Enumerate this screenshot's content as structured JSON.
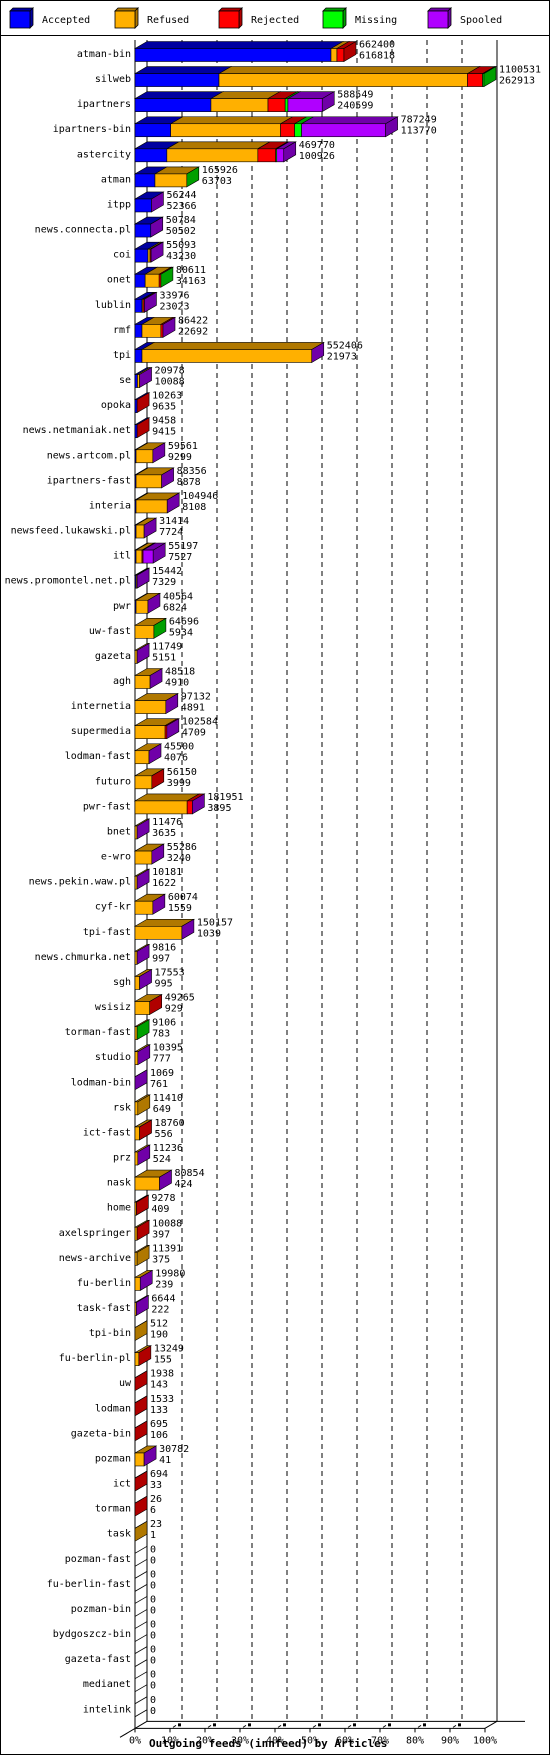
{
  "chart_data": {
    "type": "bar",
    "orientation": "horizontal",
    "stacked": true,
    "style": "3d",
    "title": "Outgoing feeds (innfeed) by Articles",
    "xlabel": "Outgoing feeds (innfeed) by Articles",
    "ylabel": "",
    "xlim": [
      0,
      100
    ],
    "x_ticks": [
      "0%",
      "10%",
      "20%",
      "30%",
      "40%",
      "50%",
      "60%",
      "70%",
      "80%",
      "90%",
      "100%"
    ],
    "grid": "vertical-dashed",
    "legend_position": "top",
    "legend": [
      {
        "name": "Accepted",
        "color": "#0000ff",
        "side": "#0000a0"
      },
      {
        "name": "Refused",
        "color": "#ffb000",
        "side": "#b07800"
      },
      {
        "name": "Rejected",
        "color": "#ff0000",
        "side": "#b00000"
      },
      {
        "name": "Missing",
        "color": "#00ff00",
        "side": "#00a000"
      },
      {
        "name": "Spooled",
        "color": "#b000ff",
        "side": "#7000a8"
      }
    ],
    "units_note": "segment values are percent of axis width (estimated)",
    "rows": [
      {
        "name": "atman-bin",
        "top": "662400",
        "bottom": "616818",
        "seg": [
          56,
          1.7,
          2,
          0,
          0
        ]
      },
      {
        "name": "silweb",
        "top": "1100531",
        "bottom": "262913",
        "seg": [
          24,
          71,
          4.3,
          0.4,
          0
        ]
      },
      {
        "name": "ipartners",
        "top": "588549",
        "bottom": "240599",
        "seg": [
          21.7,
          16.3,
          4.9,
          0.8,
          9.8
        ]
      },
      {
        "name": "ipartners-bin",
        "top": "787249",
        "bottom": "113770",
        "seg": [
          10.2,
          31.4,
          4,
          2,
          24
        ]
      },
      {
        "name": "astercity",
        "top": "469770",
        "bottom": "100926",
        "seg": [
          9.1,
          26,
          5.1,
          0.3,
          2
        ]
      },
      {
        "name": "atman",
        "top": "165926",
        "bottom": "63703",
        "seg": [
          5.7,
          9.1,
          0,
          0,
          0
        ],
        "last_side": "missing"
      },
      {
        "name": "itpp",
        "top": "56244",
        "bottom": "52366",
        "seg": [
          4.7,
          0,
          0,
          0,
          0
        ],
        "last_side": "spooled"
      },
      {
        "name": "news.connecta.pl",
        "top": "50784",
        "bottom": "50502",
        "seg": [
          4.5,
          0,
          0,
          0,
          0
        ],
        "last_side": "spooled"
      },
      {
        "name": "coi",
        "top": "55093",
        "bottom": "43230",
        "seg": [
          3.7,
          0.6,
          0.3,
          0,
          0
        ],
        "last_side": "spooled"
      },
      {
        "name": "onet",
        "top": "80611",
        "bottom": "34163",
        "seg": [
          2.9,
          4,
          0.5,
          0,
          0
        ],
        "last_side": "missing"
      },
      {
        "name": "lublin",
        "top": "33976",
        "bottom": "23023",
        "seg": [
          2,
          0.3,
          0.4,
          0,
          0
        ],
        "last_side": "spooled"
      },
      {
        "name": "rmf",
        "top": "86422",
        "bottom": "22692",
        "seg": [
          2,
          5.4,
          0.6,
          0,
          0
        ],
        "last_side": "spooled"
      },
      {
        "name": "tpi",
        "top": "552406",
        "bottom": "21973",
        "seg": [
          2,
          48.5,
          0,
          0,
          0
        ],
        "last_side": "spooled"
      },
      {
        "name": "se",
        "top": "20978",
        "bottom": "10088",
        "seg": [
          0.7,
          0.6,
          0,
          0,
          0
        ],
        "last_side": "spooled"
      },
      {
        "name": "opoka",
        "top": "10263",
        "bottom": "9635",
        "seg": [
          0.6,
          0,
          0,
          0,
          0
        ],
        "last_side": "rejected"
      },
      {
        "name": "news.netmaniak.net",
        "top": "9458",
        "bottom": "9415",
        "seg": [
          0.6,
          0,
          0,
          0,
          0
        ],
        "last_side": "rejected"
      },
      {
        "name": "news.artcom.pl",
        "top": "59561",
        "bottom": "9299",
        "seg": [
          0.3,
          4.8,
          0,
          0,
          0
        ],
        "last_side": "spooled"
      },
      {
        "name": "ipartners-fast",
        "top": "88356",
        "bottom": "8878",
        "seg": [
          0.3,
          7.3,
          0,
          0,
          0
        ],
        "last_side": "spooled"
      },
      {
        "name": "interia",
        "top": "104946",
        "bottom": "8108",
        "seg": [
          0.3,
          8.9,
          0,
          0,
          0
        ],
        "last_side": "spooled"
      },
      {
        "name": "newsfeed.lukawski.pl",
        "top": "31414",
        "bottom": "7724",
        "seg": [
          0.3,
          2.3,
          0,
          0,
          0
        ],
        "last_side": "spooled"
      },
      {
        "name": "itl",
        "top": "55197",
        "bottom": "7527",
        "seg": [
          0.3,
          1.7,
          0.3,
          0,
          2.9
        ],
        "last_side": "spooled"
      },
      {
        "name": "news.promontel.net.pl",
        "top": "15442",
        "bottom": "7329",
        "seg": [
          0.3,
          0.3,
          0,
          0,
          0
        ],
        "last_side": "spooled"
      },
      {
        "name": "pwr",
        "top": "40564",
        "bottom": "6824",
        "seg": [
          0.3,
          3.4,
          0,
          0,
          0
        ],
        "last_side": "spooled"
      },
      {
        "name": "uw-fast",
        "top": "64696",
        "bottom": "5934",
        "seg": [
          0,
          5.4,
          0,
          0,
          0
        ],
        "last_side": "missing"
      },
      {
        "name": "gazeta",
        "top": "11749",
        "bottom": "5151",
        "seg": [
          0,
          0.6,
          0,
          0,
          0
        ],
        "last_side": "spooled"
      },
      {
        "name": "agh",
        "top": "48518",
        "bottom": "4910",
        "seg": [
          0,
          4.3,
          0,
          0,
          0
        ],
        "last_side": "spooled"
      },
      {
        "name": "internetia",
        "top": "97132",
        "bottom": "4891",
        "seg": [
          0,
          8.8,
          0,
          0,
          0
        ],
        "last_side": "spooled"
      },
      {
        "name": "supermedia",
        "top": "102584",
        "bottom": "4709",
        "seg": [
          0,
          8.6,
          0.5,
          0,
          0
        ],
        "last_side": "spooled"
      },
      {
        "name": "lodman-fast",
        "top": "45500",
        "bottom": "4076",
        "seg": [
          0,
          4,
          0,
          0,
          0
        ],
        "last_side": "spooled"
      },
      {
        "name": "futuro",
        "top": "56150",
        "bottom": "3999",
        "seg": [
          0,
          4.8,
          0,
          0,
          0
        ],
        "last_side": "rejected"
      },
      {
        "name": "pwr-fast",
        "top": "181951",
        "bottom": "3895",
        "seg": [
          0,
          14.9,
          1.5,
          0,
          0
        ],
        "last_side": "spooled"
      },
      {
        "name": "bnet",
        "top": "11476",
        "bottom": "3635",
        "seg": [
          0,
          0.6,
          0,
          0,
          0
        ],
        "last_side": "spooled"
      },
      {
        "name": "e-wro",
        "top": "55286",
        "bottom": "3240",
        "seg": [
          0,
          4.8,
          0,
          0,
          0
        ],
        "last_side": "spooled"
      },
      {
        "name": "news.pekin.waw.pl",
        "top": "10181",
        "bottom": "1622",
        "seg": [
          0,
          0.6,
          0,
          0,
          0
        ],
        "last_side": "spooled"
      },
      {
        "name": "cyf-kr",
        "top": "60074",
        "bottom": "1559",
        "seg": [
          0,
          5.1,
          0,
          0,
          0
        ],
        "last_side": "spooled"
      },
      {
        "name": "tpi-fast",
        "top": "150157",
        "bottom": "1039",
        "seg": [
          0,
          13.4,
          0,
          0,
          0
        ],
        "last_side": "spooled"
      },
      {
        "name": "news.chmurka.net",
        "top": "9816",
        "bottom": "997",
        "seg": [
          0,
          0.6,
          0,
          0,
          0
        ],
        "last_side": "spooled"
      },
      {
        "name": "sgh",
        "top": "17553",
        "bottom": "995",
        "seg": [
          0,
          1.3,
          0,
          0,
          0
        ],
        "last_side": "spooled"
      },
      {
        "name": "wsisiz",
        "top": "49265",
        "bottom": "929",
        "seg": [
          0,
          4.2,
          0,
          0,
          0
        ],
        "last_side": "rejected"
      },
      {
        "name": "torman-fast",
        "top": "9106",
        "bottom": "783",
        "seg": [
          0,
          0.6,
          0,
          0,
          0
        ],
        "last_side": "missing"
      },
      {
        "name": "studio",
        "top": "10395",
        "bottom": "777",
        "seg": [
          0,
          0.8,
          0,
          0,
          0
        ],
        "last_side": "spooled"
      },
      {
        "name": "lodman-bin",
        "top": "1069",
        "bottom": "761",
        "seg": [
          0,
          0,
          0,
          0,
          0
        ],
        "last_side": "spooled"
      },
      {
        "name": "rsk",
        "top": "11410",
        "bottom": "649",
        "seg": [
          0,
          0.8,
          0,
          0,
          0
        ],
        "last_side": "refused"
      },
      {
        "name": "ict-fast",
        "top": "18760",
        "bottom": "556",
        "seg": [
          0,
          1.3,
          0,
          0,
          0
        ],
        "last_side": "rejected"
      },
      {
        "name": "prz",
        "top": "11236",
        "bottom": "524",
        "seg": [
          0,
          0.8,
          0,
          0,
          0
        ],
        "last_side": "spooled"
      },
      {
        "name": "nask",
        "top": "80854",
        "bottom": "424",
        "seg": [
          0,
          7,
          0,
          0,
          0
        ],
        "last_side": "spooled"
      },
      {
        "name": "home",
        "top": "9278",
        "bottom": "409",
        "seg": [
          0,
          0.4,
          0,
          0,
          0
        ],
        "last_side": "rejected"
      },
      {
        "name": "axelspringer",
        "top": "10088",
        "bottom": "397",
        "seg": [
          0,
          0.6,
          0,
          0,
          0
        ],
        "last_side": "rejected"
      },
      {
        "name": "news-archive",
        "top": "11391",
        "bottom": "375",
        "seg": [
          0,
          0.6,
          0,
          0,
          0
        ],
        "last_side": "refused"
      },
      {
        "name": "fu-berlin",
        "top": "19980",
        "bottom": "239",
        "seg": [
          0,
          1.5,
          0,
          0,
          0
        ],
        "last_side": "spooled"
      },
      {
        "name": "task-fast",
        "top": "6644",
        "bottom": "222",
        "seg": [
          0,
          0.4,
          0,
          0,
          0
        ],
        "last_side": "spooled"
      },
      {
        "name": "tpi-bin",
        "top": "512",
        "bottom": "190",
        "seg": [
          0,
          0,
          0,
          0,
          0
        ],
        "last_side": "refused"
      },
      {
        "name": "fu-berlin-pl",
        "top": "13249",
        "bottom": "155",
        "seg": [
          0,
          1.1,
          0,
          0,
          0
        ],
        "last_side": "rejected"
      },
      {
        "name": "uw",
        "top": "1938",
        "bottom": "143",
        "seg": [
          0,
          0,
          0,
          0,
          0
        ],
        "last_side": "rejected"
      },
      {
        "name": "lodman",
        "top": "1533",
        "bottom": "133",
        "seg": [
          0,
          0,
          0,
          0,
          0
        ],
        "last_side": "rejected"
      },
      {
        "name": "gazeta-bin",
        "top": "695",
        "bottom": "106",
        "seg": [
          0,
          0,
          0,
          0,
          0
        ],
        "last_side": "rejected"
      },
      {
        "name": "pozman",
        "top": "30782",
        "bottom": "41",
        "seg": [
          0,
          2.6,
          0,
          0,
          0
        ],
        "last_side": "spooled"
      },
      {
        "name": "ict",
        "top": "694",
        "bottom": "33",
        "seg": [
          0,
          0,
          0,
          0,
          0
        ],
        "last_side": "rejected"
      },
      {
        "name": "torman",
        "top": "26",
        "bottom": "6",
        "seg": [
          0,
          0,
          0,
          0,
          0
        ],
        "last_side": "rejected"
      },
      {
        "name": "task",
        "top": "23",
        "bottom": "1",
        "seg": [
          0,
          0,
          0,
          0,
          0
        ],
        "last_side": "refused"
      },
      {
        "name": "pozman-fast",
        "top": "0",
        "bottom": "0",
        "seg": [
          0,
          0,
          0,
          0,
          0
        ],
        "last_side": "none"
      },
      {
        "name": "fu-berlin-fast",
        "top": "0",
        "bottom": "0",
        "seg": [
          0,
          0,
          0,
          0,
          0
        ],
        "last_side": "none"
      },
      {
        "name": "pozman-bin",
        "top": "0",
        "bottom": "0",
        "seg": [
          0,
          0,
          0,
          0,
          0
        ],
        "last_side": "none"
      },
      {
        "name": "bydgoszcz-bin",
        "top": "0",
        "bottom": "0",
        "seg": [
          0,
          0,
          0,
          0,
          0
        ],
        "last_side": "none"
      },
      {
        "name": "gazeta-fast",
        "top": "0",
        "bottom": "0",
        "seg": [
          0,
          0,
          0,
          0,
          0
        ],
        "last_side": "none"
      },
      {
        "name": "medianet",
        "top": "0",
        "bottom": "0",
        "seg": [
          0,
          0,
          0,
          0,
          0
        ],
        "last_side": "none"
      },
      {
        "name": "intelink",
        "top": "0",
        "bottom": "0",
        "seg": [
          0,
          0,
          0,
          0,
          0
        ],
        "last_side": "none"
      }
    ]
  }
}
